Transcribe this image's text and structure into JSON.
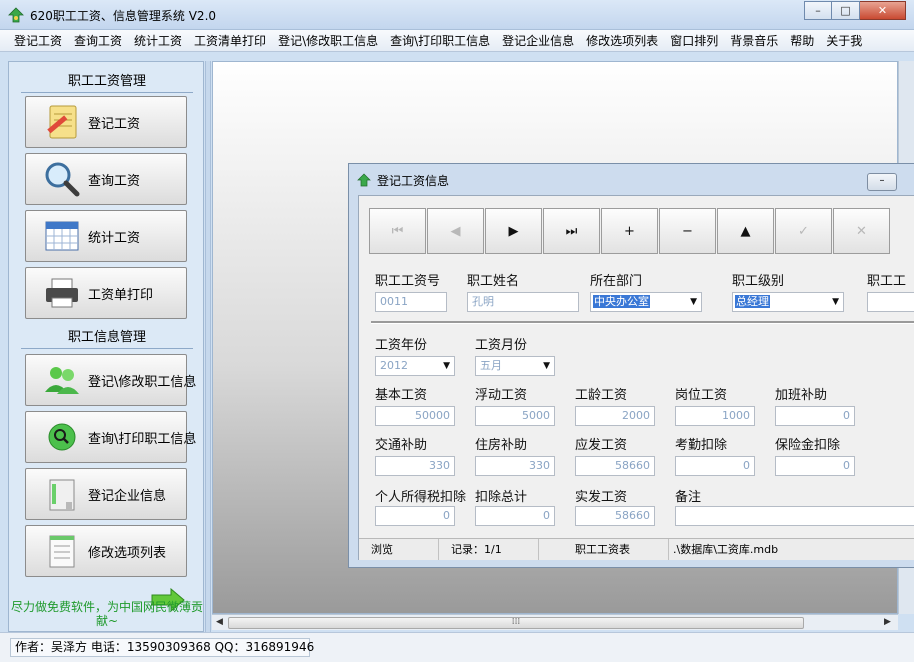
{
  "app": {
    "title": "620职工工资、信息管理系统 V2.0",
    "window_buttons": [
      "–",
      "□",
      "✕"
    ]
  },
  "menu": [
    "登记工资",
    "查询工资",
    "统计工资",
    "工资清单打印",
    "登记\\修改职工信息",
    "查询\\打印职工信息",
    "登记企业信息",
    "修改选项列表",
    "窗口排列",
    "背景音乐",
    "帮助",
    "关于我"
  ],
  "sidebar": {
    "group1_title": "职工工资管理",
    "group2_title": "职工信息管理",
    "buttons": [
      {
        "label": "登记工资",
        "icon": "notepad-pencil-icon"
      },
      {
        "label": "查询工资",
        "icon": "magnifier-icon"
      },
      {
        "label": "统计工资",
        "icon": "calendar-grid-icon"
      },
      {
        "label": "工资单打印",
        "icon": "printer-icon"
      },
      {
        "label": "登记\\修改职工信息",
        "icon": "users-icon"
      },
      {
        "label": "查询\\打印职工信息",
        "icon": "search-badge-icon"
      },
      {
        "label": "登记企业信息",
        "icon": "building-icon"
      },
      {
        "label": "修改选项列表",
        "icon": "list-form-icon"
      }
    ],
    "footer": "尽力做免费软件，为中国网民微薄贡献~"
  },
  "status": {
    "author": "作者：吴泽方 电话：13590309368  QQ：316891946"
  },
  "child": {
    "title": "登记工资信息",
    "min_button": "–",
    "toolbar": [
      "⏮",
      "◀",
      "▶",
      "⏭",
      "+",
      "−",
      "▲",
      "✓",
      "✕"
    ],
    "fields": {
      "emp_id_label": "职工工资号",
      "emp_id": "0011",
      "emp_name_label": "职工姓名",
      "emp_name": "孔明",
      "dept_label": "所在部门",
      "dept": "中央办公室",
      "level_label": "职工级别",
      "level": "总经理",
      "extra_label": "职工工",
      "year_label": "工资年份",
      "year": "2012",
      "month_label": "工资月份",
      "month": "五月",
      "base_label": "基本工资",
      "base": "50000",
      "float_label": "浮动工资",
      "float": "5000",
      "seniority_label": "工龄工资",
      "seniority": "2000",
      "post_label": "岗位工资",
      "post": "1000",
      "overtime_label": "加班补助",
      "overtime": "0",
      "transport_label": "交通补助",
      "transport": "330",
      "housing_label": "住房补助",
      "housing": "330",
      "gross_label": "应发工资",
      "gross": "58660",
      "attendance_label": "考勤扣除",
      "attendance": "0",
      "insurance_label": "保险金扣除",
      "insurance": "0",
      "tax_label": "个人所得税扣除",
      "tax": "0",
      "deduct_label": "扣除总计",
      "deduct": "0",
      "net_label": "实发工资",
      "net": "58660",
      "remark_label": "备注",
      "remark": ""
    },
    "statusbar": {
      "mode": "浏览",
      "record": "记录：1/1",
      "table": "职工工资表",
      "path": ".\\数据库\\工资库.mdb"
    }
  },
  "colors": {
    "accent": "#3a78d6",
    "footer_green": "#1f9a2c",
    "field_text": "#8aa4c4"
  }
}
